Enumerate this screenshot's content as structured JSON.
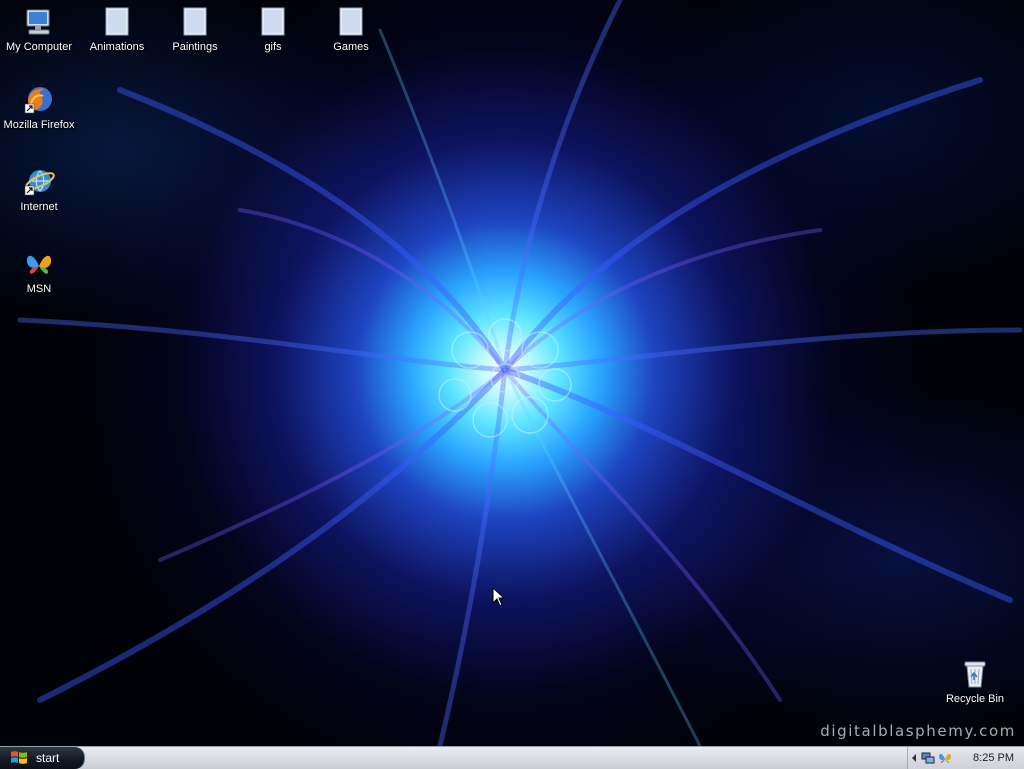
{
  "desktop": {
    "icons": [
      {
        "id": "my-computer",
        "label": "My Computer",
        "icon": "computer-icon"
      },
      {
        "id": "animations",
        "label": "Animations",
        "icon": "folder-icon"
      },
      {
        "id": "paintings",
        "label": "Paintings",
        "icon": "folder-icon"
      },
      {
        "id": "gifs",
        "label": "gifs",
        "icon": "folder-icon"
      },
      {
        "id": "games",
        "label": "Games",
        "icon": "folder-icon"
      },
      {
        "id": "mozilla-firefox",
        "label": "Mozilla Firefox",
        "icon": "firefox-icon"
      },
      {
        "id": "internet",
        "label": "Internet",
        "icon": "internet-explorer-icon"
      },
      {
        "id": "msn",
        "label": "MSN",
        "icon": "msn-butterfly-icon"
      },
      {
        "id": "recycle-bin",
        "label": "Recycle Bin",
        "icon": "recycle-bin-icon"
      }
    ],
    "watermark": "digitalblasphemy.com"
  },
  "taskbar": {
    "start_label": "start",
    "tray_icons": [
      "network-icon",
      "msn-tray-icon"
    ],
    "clock": "8:25 PM"
  },
  "colors": {
    "taskbar": "#dcdfe5",
    "start_button": "#131a25",
    "wallpaper_glow": "#5fe6ff",
    "wallpaper_blue": "#2a40ff"
  }
}
